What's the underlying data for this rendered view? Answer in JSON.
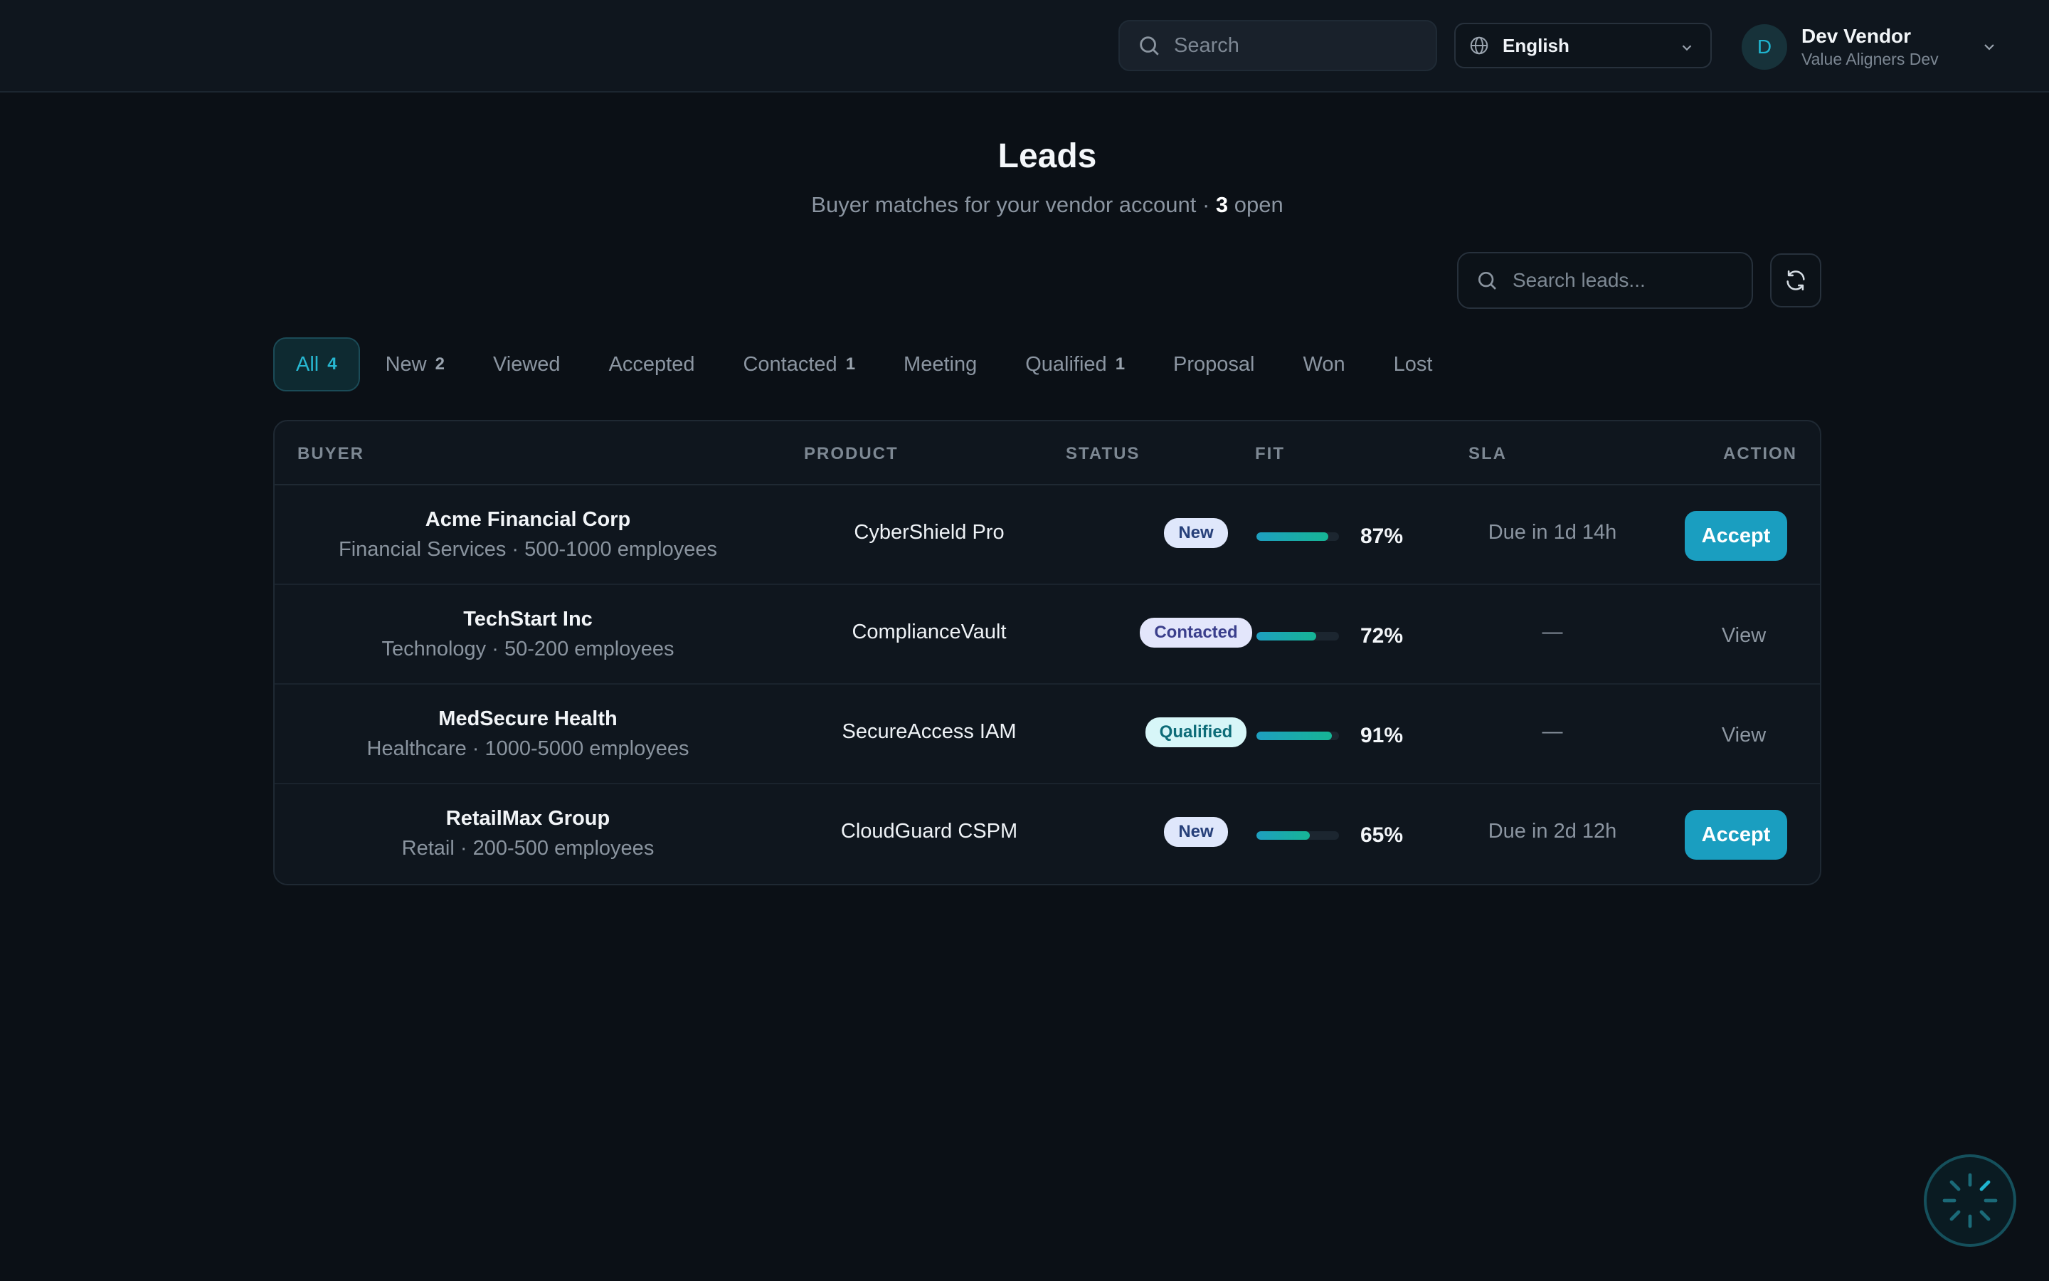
{
  "topbar": {
    "search_placeholder": "Search",
    "language": "English",
    "user": {
      "initial": "D",
      "name": "Dev Vendor",
      "org": "Value Aligners Dev"
    }
  },
  "page": {
    "title": "Leads",
    "subtitle_prefix": "Buyer matches for your vendor account · ",
    "open_count": "3",
    "subtitle_suffix": " open",
    "search_placeholder": "Search leads..."
  },
  "tabs": [
    {
      "label": "All",
      "badge": "4",
      "active": true
    },
    {
      "label": "New",
      "badge": "2"
    },
    {
      "label": "Viewed",
      "badge": ""
    },
    {
      "label": "Accepted",
      "badge": ""
    },
    {
      "label": "Contacted",
      "badge": "1"
    },
    {
      "label": "Meeting",
      "badge": ""
    },
    {
      "label": "Qualified",
      "badge": "1"
    },
    {
      "label": "Proposal",
      "badge": ""
    },
    {
      "label": "Won",
      "badge": ""
    },
    {
      "label": "Lost",
      "badge": ""
    }
  ],
  "table": {
    "headers": {
      "buyer": "BUYER",
      "product": "PRODUCT",
      "status": "STATUS",
      "fit": "FIT",
      "sla": "SLA",
      "action": "ACTION"
    },
    "rows": [
      {
        "buyer": "Acme Financial Corp",
        "meta": "Financial Services · 500-1000 employees",
        "product": "CyberShield Pro",
        "status": "New",
        "status_kind": "new",
        "fit": 87,
        "fit_label": "87%",
        "sla": "Due in 1d 14h",
        "action": "Accept",
        "action_kind": "accept"
      },
      {
        "buyer": "TechStart Inc",
        "meta": "Technology · 50-200 employees",
        "product": "ComplianceVault",
        "status": "Contacted",
        "status_kind": "contacted",
        "fit": 72,
        "fit_label": "72%",
        "sla": "—",
        "action": "View",
        "action_kind": "view"
      },
      {
        "buyer": "MedSecure Health",
        "meta": "Healthcare · 1000-5000 employees",
        "product": "SecureAccess IAM",
        "status": "Qualified",
        "status_kind": "qualified",
        "fit": 91,
        "fit_label": "91%",
        "sla": "—",
        "action": "View",
        "action_kind": "view"
      },
      {
        "buyer": "RetailMax Group",
        "meta": "Retail · 200-500 employees",
        "product": "CloudGuard CSPM",
        "status": "New",
        "status_kind": "new",
        "fit": 65,
        "fit_label": "65%",
        "sla": "Due in 2d 12h",
        "action": "Accept",
        "action_kind": "accept"
      }
    ]
  },
  "colors": {
    "accent": "#1a9ec0",
    "background": "#0b1016",
    "surface": "#0f161e"
  },
  "icons": {
    "search": "search-icon",
    "language": "globe-icon",
    "refresh": "refresh-icon",
    "dropdown": "chevron-down-icon",
    "widget": "loading-spinner-icon"
  }
}
